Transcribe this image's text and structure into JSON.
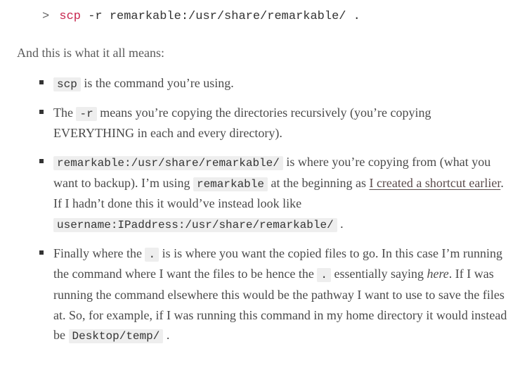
{
  "command": {
    "prompt": ">",
    "name": "scp",
    "rest": " -r remarkable:/usr/share/remarkable/ ."
  },
  "lead": "And this is what it all means:",
  "items": [
    {
      "code1": "scp",
      "t1": " is the command you’re using."
    },
    {
      "t0": "The ",
      "code1": "-r",
      "t1": " means you’re copying the directories recursively (you’re copying EVERYTHING in each and every directory)."
    },
    {
      "code1": "remarkable:/usr/share/remarkable/",
      "t1": " is where you’re copying from (what you want to backup). I’m using ",
      "code2": "remarkable",
      "t2": " at the beginning as ",
      "link": "I created a shortcut earlier",
      "t3": ". If I hadn’t done this it would’ve instead look like ",
      "code3": "username:IPaddress:/usr/share/remarkable/",
      "t4": " ."
    },
    {
      "t0": "Finally where the ",
      "code1": ".",
      "t1": " is is where you want the copied files to go. In this case I’m running the command where I want the files to be hence the ",
      "code2": ".",
      "t2": " essentially saying ",
      "ital": "here",
      "t3": ". If I was running the command elsewhere this would be the pathway I want to use to save the files at. So, for example, if I was running this command in my home directory it would instead be ",
      "code3": "Desktop/temp/",
      "t4": " ."
    }
  ]
}
